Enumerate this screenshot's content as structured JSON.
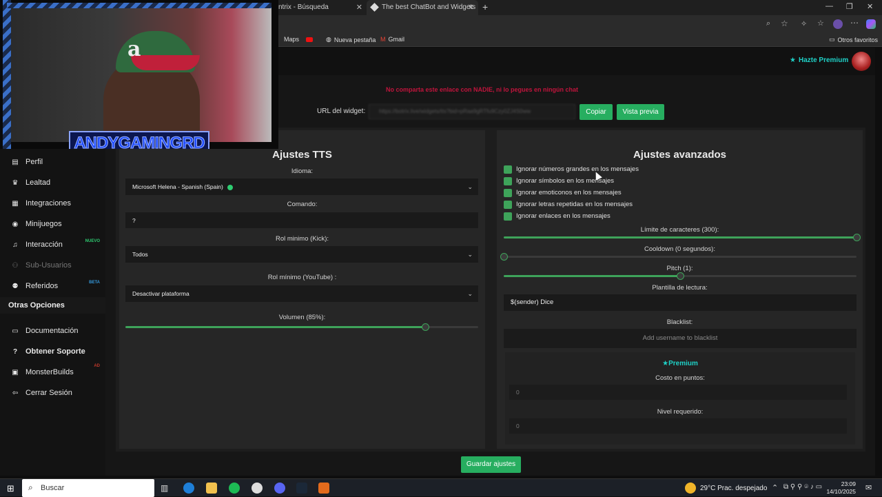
{
  "browser": {
    "tabs": [
      {
        "label": "ntrix - Búsqueda"
      },
      {
        "label": "The best ChatBot and Widgets fo"
      }
    ],
    "bookmarks": [
      "Maps",
      "Nueva pestaña",
      "Gmail"
    ],
    "other_bookmarks": "Otros favoritos"
  },
  "header": {
    "premium_link": "Hazte Premium"
  },
  "widget": {
    "warning": "No comparta este enlace con NADIE, ni lo pegues en ningún chat",
    "url_label": "URL del widget:",
    "url_value": "https://botrix.live/widgets/tts?bid=pRaa9gRTfu9Czy0ZJ4S0ww",
    "copy_button": "Copiar",
    "preview_button": "Vista previa"
  },
  "sidebar": {
    "items": [
      {
        "label": "Perfil",
        "icon": "id-card-icon"
      },
      {
        "label": "Lealtad",
        "icon": "trophy-icon"
      },
      {
        "label": "Integraciones",
        "icon": "grid-icon"
      },
      {
        "label": "Minijuegos",
        "icon": "gamepad-icon"
      },
      {
        "label": "Interacción",
        "icon": "music-icon",
        "badge": "NUEVO"
      },
      {
        "label": "Sub-Usuarios",
        "icon": "users-icon",
        "disabled": true
      },
      {
        "label": "Referidos",
        "icon": "user-plus-icon",
        "badge": "BETA"
      }
    ],
    "section_title": "Otras Opciones",
    "other_items": [
      {
        "label": "Documentación",
        "icon": "book-icon"
      },
      {
        "label": "Obtener Soporte",
        "icon": "help-icon"
      },
      {
        "label": "MonsterBuilds",
        "icon": "monitor-icon",
        "badge": "AD"
      },
      {
        "label": "Cerrar Sesión",
        "icon": "logout-icon"
      }
    ]
  },
  "tts": {
    "title": "Ajustes TTS",
    "language_label": "Idioma:",
    "language_value": "Microsoft Helena - Spanish (Spain)",
    "command_label": "Comando:",
    "command_value": "?",
    "kick_role_label": "Rol minimo (Kick):",
    "kick_role_value": "Todos",
    "youtube_role_label": "Rol mínimo (YouTube) :",
    "youtube_role_value": "Desactivar plataforma",
    "volume_label": "Volumen (85%):",
    "volume_percent": 85
  },
  "advanced": {
    "title": "Ajustes avanzados",
    "checkboxes": [
      "Ignorar números grandes en los mensajes",
      "Ignorar símbolos en los mensajes",
      "Ignorar emoticonos en los mensajes",
      "Ignorar letras repetidas en los mensajes",
      "Ignorar enlaces en los mensajes"
    ],
    "char_limit_label": "Límite de caracteres (300):",
    "char_limit_fraction": 1.0,
    "cooldown_label": "Cooldown (0 segundos):",
    "cooldown_fraction": 0.0,
    "pitch_label": "Pitch (1):",
    "pitch_fraction": 0.5,
    "template_label": "Plantilla de lectura:",
    "template_value": "$(sender) Dice",
    "blacklist_label": "Blacklist:",
    "blacklist_placeholder": "Add username to blacklist",
    "premium_title": "Premium",
    "cost_label": "Costo en puntos:",
    "cost_value": "0",
    "level_label": "Nivel requerido:",
    "level_value": "0"
  },
  "save_button": "Guardar ajustes",
  "webcam": {
    "overlay_name": "ANDYGAMINGRD"
  },
  "taskbar": {
    "search_placeholder": "Buscar",
    "weather": "29°C  Prac. despejado",
    "time": "23:09",
    "date": "14/10/2025"
  },
  "colors": {
    "accent_green": "#27ae60",
    "warning_red": "#c0143c",
    "premium_cyan": "#1fd1c7"
  }
}
